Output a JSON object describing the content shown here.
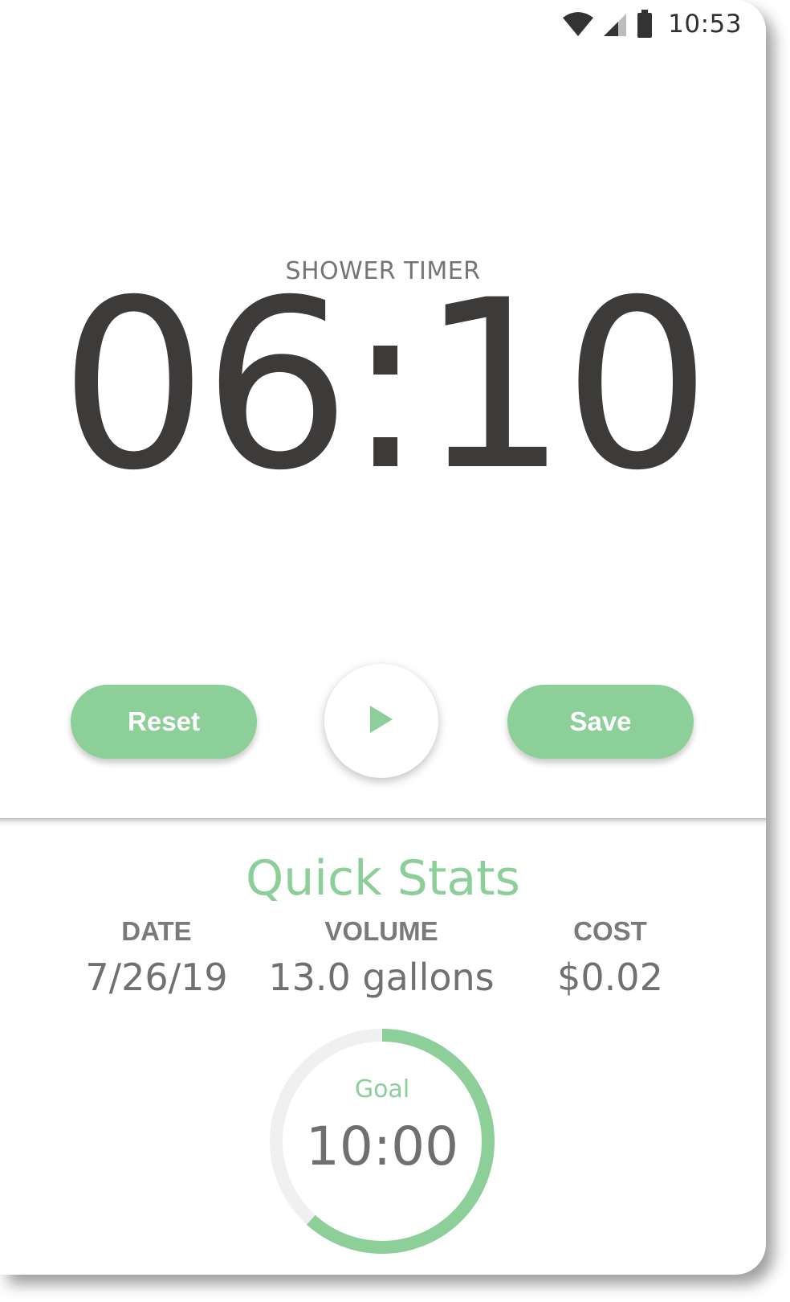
{
  "status_bar": {
    "time": "10:53",
    "icons": [
      "wifi-icon",
      "signal-icon",
      "battery-icon"
    ]
  },
  "timer": {
    "label": "SHOWER TIMER",
    "value": "06:10"
  },
  "controls": {
    "reset_label": "Reset",
    "play_icon": "play-icon",
    "save_label": "Save"
  },
  "stats": {
    "title": "Quick Stats",
    "columns": [
      {
        "header": "DATE",
        "value": "7/26/19"
      },
      {
        "header": "VOLUME",
        "value": "13.0 gallons"
      },
      {
        "header": "COST",
        "value": "$0.02"
      }
    ]
  },
  "goal": {
    "label": "Goal",
    "value": "10:00",
    "progress_fraction": 0.617
  },
  "colors": {
    "accent": "#8ccf99",
    "timer_text": "#3d3a3a",
    "muted_text": "#757575",
    "ring_track": "#f0f0f0"
  }
}
